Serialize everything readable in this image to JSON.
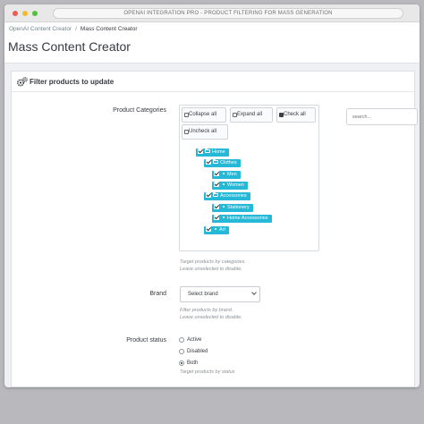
{
  "browser": {
    "address_text": "OPENAI INTEGRATION PRO - PRODUCT FILTERING FOR MASS GENERATION"
  },
  "breadcrumb": {
    "parent": "OpenAI Content Creator",
    "separator": "/",
    "current": "Mass Content Creator"
  },
  "page": {
    "title": "Mass Content Creator"
  },
  "panel": {
    "title": "Filter products to update"
  },
  "categories": {
    "label": "Product Categories",
    "buttons": {
      "collapse_all": "Collapse all",
      "expand_all": "Expand all",
      "check_all": "Check all",
      "uncheck_all": "Uncheck all"
    },
    "search_placeholder": "search...",
    "tree": [
      {
        "label": "Home",
        "type": "folder",
        "checked": true
      },
      {
        "label": "Clothes",
        "type": "folder",
        "checked": true
      },
      {
        "label": "Men",
        "type": "leaf",
        "checked": true
      },
      {
        "label": "Women",
        "type": "leaf",
        "checked": true
      },
      {
        "label": "Accessories",
        "type": "folder",
        "checked": true
      },
      {
        "label": "Stationery",
        "type": "leaf",
        "checked": true
      },
      {
        "label": "Home Accessories",
        "type": "leaf",
        "checked": true
      },
      {
        "label": "Art",
        "type": "leaf",
        "checked": true
      }
    ],
    "help_line1": "Target products by categories.",
    "help_line2": "Leave unselected to disable."
  },
  "brand": {
    "label": "Brand",
    "selected": "Select brand",
    "help_line1": "Filter products by brand.",
    "help_line2": "Leave unselected to disable."
  },
  "status": {
    "label": "Product status",
    "options": [
      {
        "label": "Active",
        "selected": false
      },
      {
        "label": "Disabled",
        "selected": false
      },
      {
        "label": "Both",
        "selected": true
      }
    ],
    "help": "Target products by status"
  },
  "colors": {
    "accent": "#25b9d7",
    "background": "#b9b9bd",
    "text": "#363a41"
  }
}
